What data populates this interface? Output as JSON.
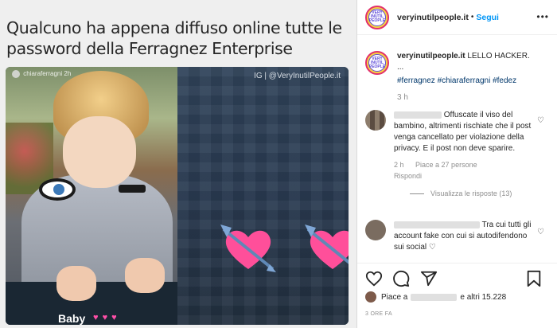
{
  "post": {
    "headline": "Qualcuno ha appena diffuso online tutte le password della Ferragnez Enterprise",
    "inner_tag": "chiaraferragni",
    "inner_tag_time": "2h",
    "watermark": "IG | @VeryInutilPeople.it",
    "baby_label": "Baby",
    "baby_hearts": "♥ ♥ ♥"
  },
  "header": {
    "username": "veryinutilpeople.it",
    "dot": "•",
    "follow": "Segui",
    "more_icon": "more-horizontal-icon",
    "avatar_text": "VERY INUTIL PEOPLE"
  },
  "caption": {
    "username": "veryinutilpeople.it",
    "text": "LELLO HACKER.",
    "ellipsis": "...",
    "hashtags": "#ferragnez #chiaraferragni #fedez",
    "time": "3 h"
  },
  "comments": [
    {
      "text": "Offuscate il viso del bambino, altrimenti rischiate che il post venga cancellato per violazione della privacy. E il post non deve sparire.",
      "time": "2 h",
      "likes": "Piace a 27 persone",
      "reply": "Rispondi",
      "view_replies": "Visualizza le risposte (13)"
    },
    {
      "text": "Tra cui tutti gli account fake con cui si autodifendono sui social ♡"
    }
  ],
  "actions": {
    "like_icon": "heart-outline-icon",
    "comment_icon": "comment-icon",
    "share_icon": "share-icon",
    "save_icon": "bookmark-icon"
  },
  "likes": {
    "prefix": "Piace a",
    "suffix": "e altri 15.228"
  },
  "date": "3 ORE FA"
}
